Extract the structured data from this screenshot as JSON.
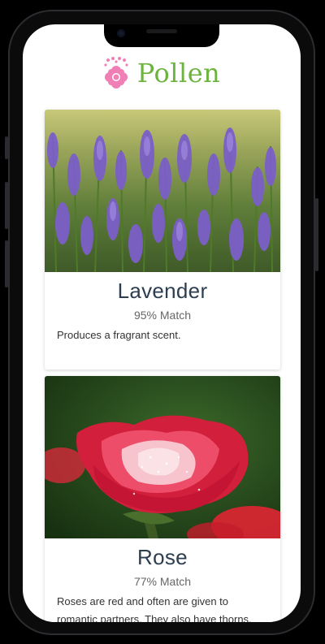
{
  "app": {
    "brand": "Pollen",
    "brand_color": "#6cb33f",
    "logo_icon": "flower-icon",
    "logo_color": "#f07fb6"
  },
  "plants": [
    {
      "name": "Lavender",
      "match": "95% Match",
      "description": "Produces a fragrant scent.",
      "photo_icon": "lavender-photo"
    },
    {
      "name": "Rose",
      "match": "77% Match",
      "description": "Roses are red and often are given to romantic partners. They also have thorns.",
      "photo_icon": "rose-photo"
    }
  ]
}
